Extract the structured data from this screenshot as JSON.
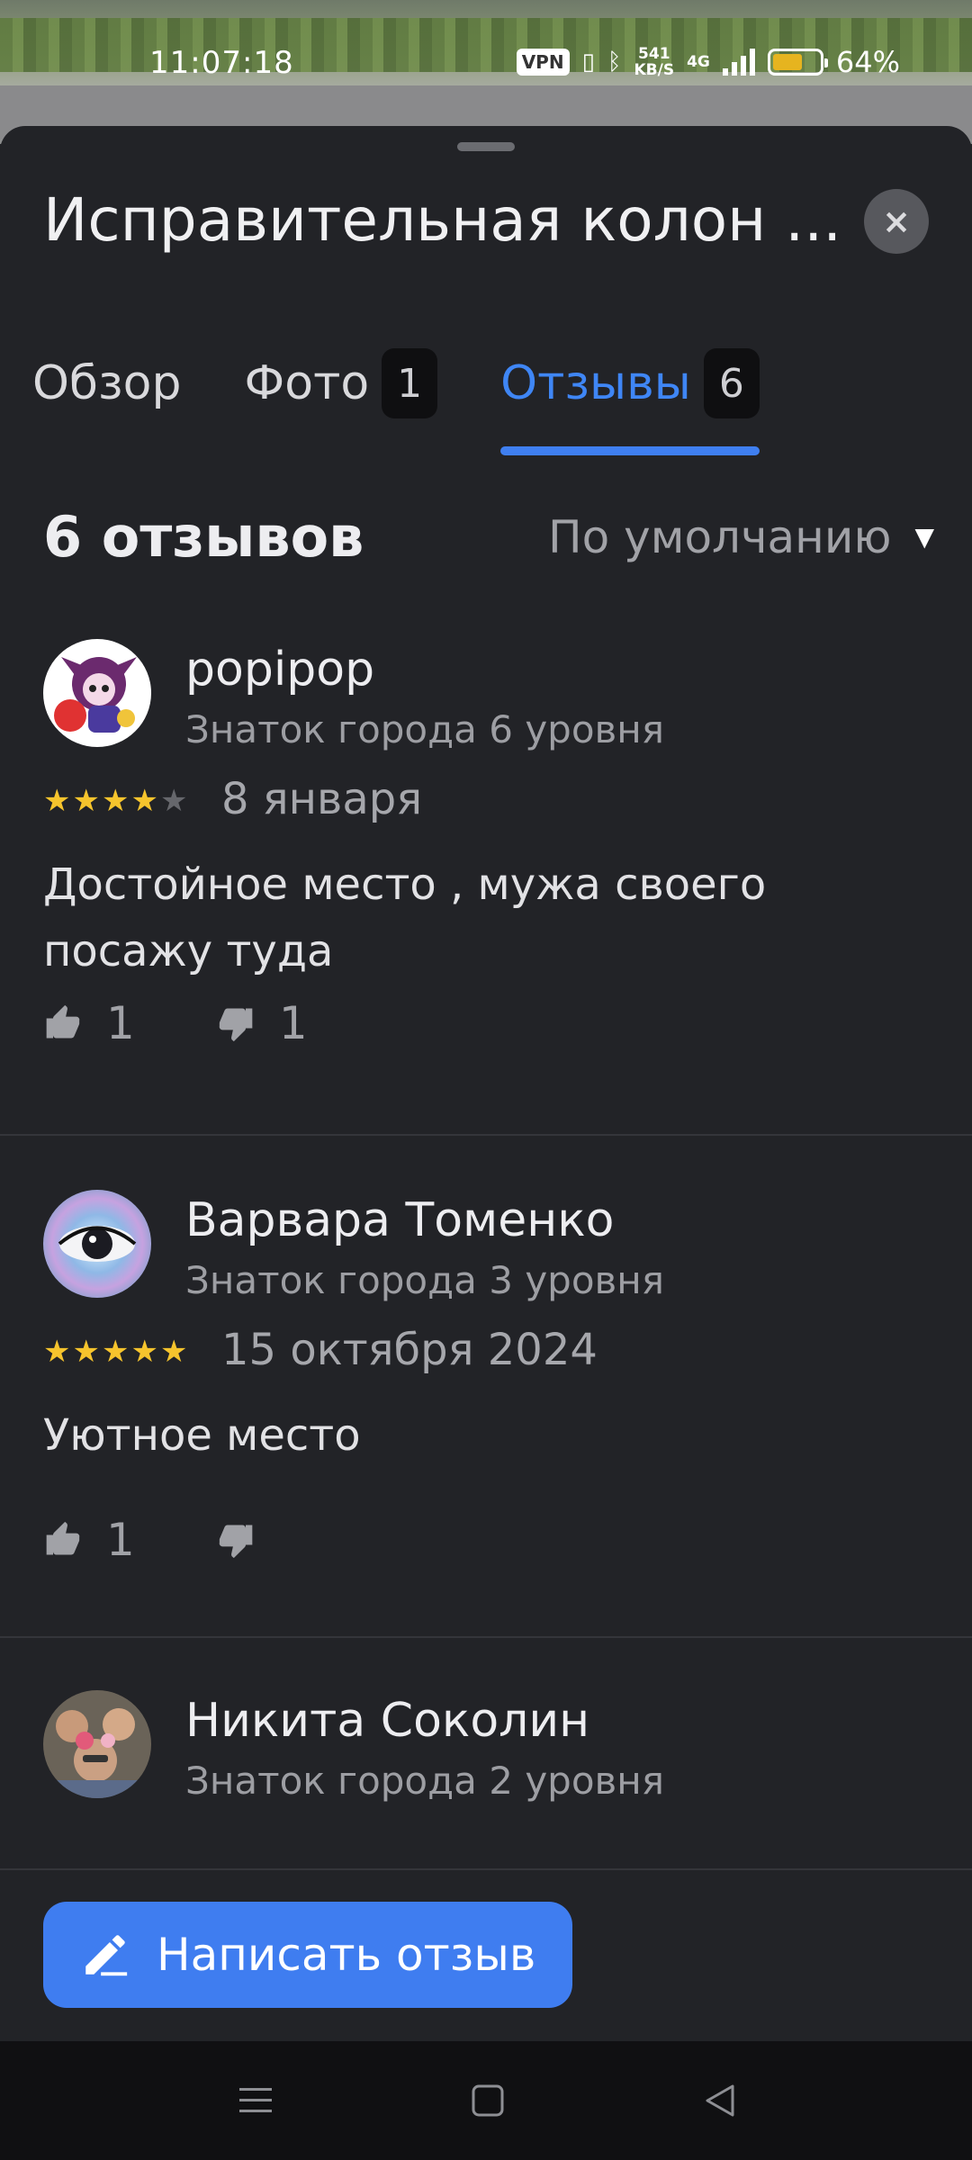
{
  "status_bar": {
    "time": "11:07:18",
    "vpn": "VPN",
    "net_speed_value": "541",
    "net_speed_unit": "KB/S",
    "network": "4G",
    "battery": "64%",
    "battery_level": 0.64
  },
  "sheet": {
    "title": "Исправительная колон ...",
    "close_label": "×"
  },
  "tabs": [
    {
      "label": "Обзор",
      "count": ""
    },
    {
      "label": "Фото",
      "count": "1"
    },
    {
      "label": "Отзывы",
      "count": "6",
      "active": true
    }
  ],
  "reviews_header": {
    "count_title": "6 отзывов",
    "sort_label": "По умолчанию"
  },
  "reviews": [
    {
      "author": "popipop",
      "level": "Знаток города 6 уровня",
      "rating": 4,
      "date": "8 января",
      "text": "Достойное место , мужа своего посажу туда",
      "likes": "1",
      "dislikes": "1"
    },
    {
      "author": "Варвара Томенко",
      "level": "Знаток города 3 уровня",
      "rating": 5,
      "date": "15 октября 2024",
      "text": "Уютное место",
      "likes": "1",
      "dislikes": ""
    },
    {
      "author": "Никита Соколин",
      "level": "Знаток города 2 уровня"
    }
  ],
  "write_button": {
    "label": "Написать отзыв"
  },
  "colors": {
    "accent": "#3f7df0",
    "star": "#f6c42d",
    "background": "#222327"
  }
}
